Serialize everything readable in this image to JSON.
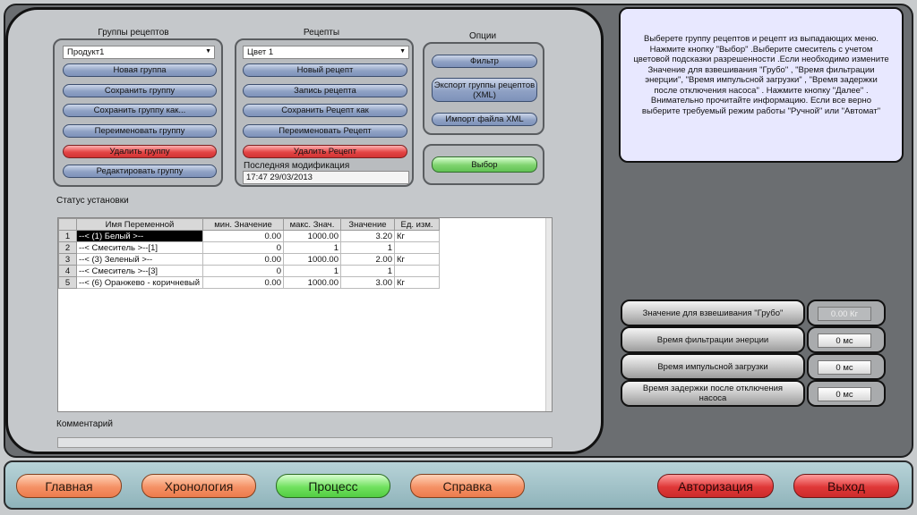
{
  "recipe_groups": {
    "title": "Группы рецептов",
    "selected": "Продукт1",
    "buttons": {
      "new_group": "Новая группа",
      "save_group": "Сохранить группу",
      "save_group_as": "Сохранить группу как...",
      "rename_group": "Переименовать группу",
      "delete_group": "Удалить группу",
      "edit_group": "Редактировать группу"
    }
  },
  "recipes": {
    "title": "Рецепты",
    "selected": "Цвет 1",
    "buttons": {
      "new_recipe": "Новый рецепт",
      "record_recipe": "Запись рецепта",
      "save_recipe_as": "Сохранить Рецепт как",
      "rename_recipe": "Переименовать Рецепт",
      "delete_recipe": "Удалить Рецепт"
    },
    "last_modified_label": "Последняя модификация",
    "last_modified_value": "17:47 29/03/2013"
  },
  "options": {
    "title": "Опции",
    "filter": "Фильтр",
    "export_xml": "Экспорт группы рецептов (XML)",
    "import_xml": "Импорт файла XML",
    "select": "Выбор"
  },
  "status": {
    "title": "Статус установки",
    "columns": [
      "Имя Переменной",
      "мин. Значение",
      "макс. Знач.",
      "Значение",
      "Ед. изм."
    ],
    "rows": [
      {
        "n": "1",
        "name": "--< (1) Белый >--",
        "min": "0.00",
        "max": "1000.00",
        "value": "3.20",
        "unit": "Кг"
      },
      {
        "n": "2",
        "name": "--< Смеситель >--[1]",
        "min": "0",
        "max": "1",
        "value": "1",
        "unit": ""
      },
      {
        "n": "3",
        "name": "--< (3) Зеленый  >--",
        "min": "0.00",
        "max": "1000.00",
        "value": "2.00",
        "unit": "Кг"
      },
      {
        "n": "4",
        "name": "--< Смеситель >--[3]",
        "min": "0",
        "max": "1",
        "value": "1",
        "unit": ""
      },
      {
        "n": "5",
        "name": "--< (6) Оранжево - коричневый",
        "min": "0.00",
        "max": "1000.00",
        "value": "3.00",
        "unit": "Кг"
      }
    ]
  },
  "comment_label": "Комментарий",
  "info_text": "Выберете группу рецептов и рецепт из выпадающих меню. Нажмите кнопку \"Выбор\" .Выберите смеситель с учетом цветовой подсказки разрешенности .Если необходимо измените Значение для взвешивания \"Грубо\" , \"Время фильтрации энерции\", \"Время импульсной загрузки\" , \"Время задержки после отключения насоса\" . Нажмите кнопку \"Далее\" . Внимательно прочитайте информацию. Если все верно выберите требуемый режим работы \"Ручной\" или \"Автомат\"",
  "params": [
    {
      "label": "Значение для взвешивания  \"Грубо\"",
      "value": "0.00 Кг"
    },
    {
      "label": "Время  фильтрации энерции",
      "value": "0 мс"
    },
    {
      "label": "Время импульсной загрузки",
      "value": "0 мс"
    },
    {
      "label": "Время задержки после отключения насоса",
      "value": "0 мс"
    }
  ],
  "nav": {
    "home": "Главная",
    "chronology": "Хронология",
    "process": "Процесс",
    "help": "Справка",
    "auth": "Авторизация",
    "exit": "Выход"
  }
}
